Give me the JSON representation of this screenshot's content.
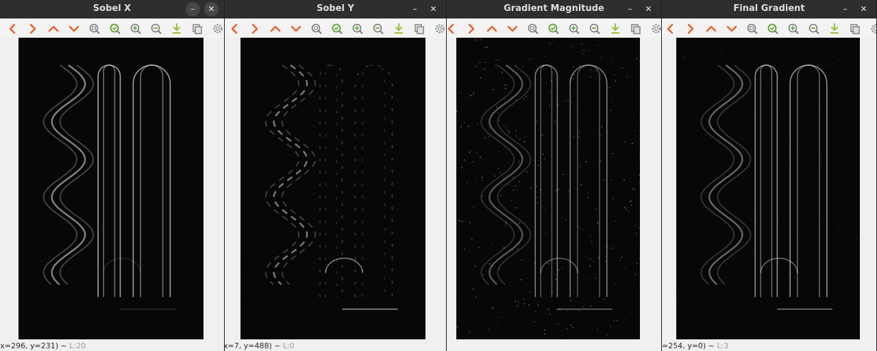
{
  "windows": [
    {
      "id": "sobel-x",
      "title": "Sobel X",
      "minimize_glyph": "–",
      "close_glyph": "✕",
      "active": true,
      "status": {
        "coords": "(x=296, y=231) ~",
        "level": "L:20"
      },
      "image": {
        "name": "sobel-x",
        "vertical_edges": 0.9,
        "horizontal_edges": 0.2,
        "noise": 0.05
      }
    },
    {
      "id": "sobel-y",
      "title": "Sobel Y",
      "minimize_glyph": "–",
      "close_glyph": "✕",
      "active": false,
      "status": {
        "coords": "x=7, y=488) ~",
        "level": "L:0"
      },
      "image": {
        "name": "sobel-y",
        "vertical_edges": 0.15,
        "horizontal_edges": 0.85,
        "noise": 0.04
      }
    },
    {
      "id": "gradient-magnitude",
      "title": "Gradient Magnitude",
      "minimize_glyph": "–",
      "close_glyph": "✕",
      "active": false,
      "status": {
        "coords": "",
        "level": ""
      },
      "image": {
        "name": "gradient-magnitude",
        "vertical_edges": 0.6,
        "horizontal_edges": 0.6,
        "noise": 0.35
      }
    },
    {
      "id": "final-gradient",
      "title": "Final Gradient",
      "minimize_glyph": "–",
      "close_glyph": "✕",
      "active": false,
      "status": {
        "coords": "=254, y=0) ~",
        "level": "L:3"
      },
      "image": {
        "name": "final-gradient",
        "vertical_edges": 0.7,
        "horizontal_edges": 0.7,
        "noise": 0.12
      }
    }
  ],
  "toolbar": [
    {
      "name": "pan-left",
      "icon": "chevron-left-icon"
    },
    {
      "name": "pan-right",
      "icon": "chevron-right-icon"
    },
    {
      "name": "pan-up",
      "icon": "chevron-up-icon"
    },
    {
      "name": "pan-down",
      "icon": "chevron-down-icon"
    },
    {
      "name": "zoom-original",
      "icon": "zoom-original-icon"
    },
    {
      "name": "zoom-fit",
      "icon": "zoom-fit-icon"
    },
    {
      "name": "zoom-in",
      "icon": "zoom-in-icon"
    },
    {
      "name": "zoom-out",
      "icon": "zoom-out-icon"
    },
    {
      "name": "save-image",
      "icon": "save-icon"
    },
    {
      "name": "copy-image",
      "icon": "copy-icon"
    },
    {
      "name": "properties",
      "icon": "gear-icon"
    }
  ],
  "colors": {
    "titlebar": "#2e2e2e",
    "arrow_orange": "#e8642c",
    "zoom_green": "#5aa02c",
    "save_yellow_green": "#9bc23c",
    "icon_gray": "#7a7a7a",
    "status_text": "#2a2a2a",
    "status_level": "#9a9a9a"
  }
}
